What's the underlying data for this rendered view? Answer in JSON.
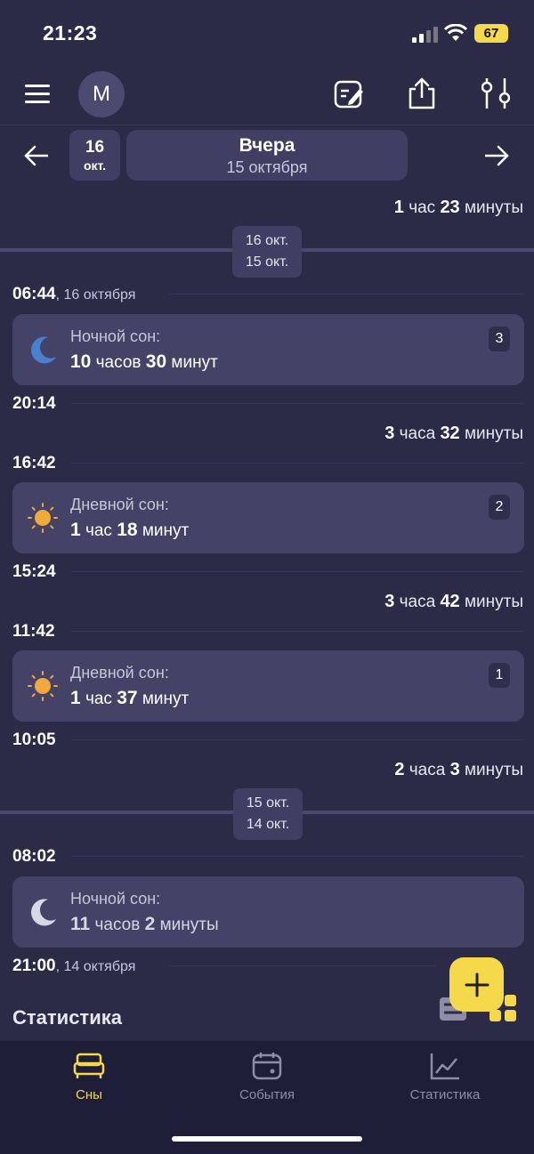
{
  "status_bar": {
    "time": "21:23",
    "battery": "67"
  },
  "header": {
    "avatar_letter": "M"
  },
  "date_nav": {
    "chip_day": "16",
    "chip_month": "окт.",
    "title": "Вчера",
    "subtitle": "15 октября"
  },
  "feed": {
    "top_duration": {
      "hours": "1",
      "hours_unit": "час",
      "minutes": "23",
      "minutes_unit": "минуты"
    },
    "divider1": {
      "top": "16 окт.",
      "bottom": "15 окт."
    },
    "t1": {
      "time": "06:44",
      "date": ", 16 октября"
    },
    "card1": {
      "title": "Ночной сон:",
      "hours": "10",
      "hours_unit": "часов",
      "minutes": "30",
      "minutes_unit": "минут",
      "count": "3"
    },
    "t2": "20:14",
    "gap1": {
      "hours": "3",
      "hours_unit": "часа",
      "minutes": "32",
      "minutes_unit": "минуты"
    },
    "t3": "16:42",
    "card2": {
      "title": "Дневной сон:",
      "hours": "1",
      "hours_unit": "час",
      "minutes": "18",
      "minutes_unit": "минут",
      "count": "2"
    },
    "t4": "15:24",
    "gap2": {
      "hours": "3",
      "hours_unit": "часа",
      "minutes": "42",
      "minutes_unit": "минуты"
    },
    "t5": "11:42",
    "card3": {
      "title": "Дневной сон:",
      "hours": "1",
      "hours_unit": "час",
      "minutes": "37",
      "minutes_unit": "минут",
      "count": "1"
    },
    "t6": "10:05",
    "gap3": {
      "hours": "2",
      "hours_unit": "часа",
      "minutes": "3",
      "minutes_unit": "минуты"
    },
    "divider2": {
      "top": "15 окт.",
      "bottom": "14 окт."
    },
    "t7": "08:02",
    "card4": {
      "title": "Ночной сон:",
      "hours": "11",
      "hours_unit": "часов",
      "minutes": "2",
      "minutes_unit": "минуты"
    },
    "t8": {
      "time": "21:00",
      "date": ", 14 октября"
    },
    "stats_title": "Статистика"
  },
  "bottom_nav": {
    "sleeps": "Сны",
    "events": "События",
    "statistics": "Статистика"
  },
  "colors": {
    "accent": "#f5d94b",
    "background": "#2b2a47",
    "card": "#444267",
    "night_moon": "#4a80d0",
    "sun": "#f0a93a"
  }
}
